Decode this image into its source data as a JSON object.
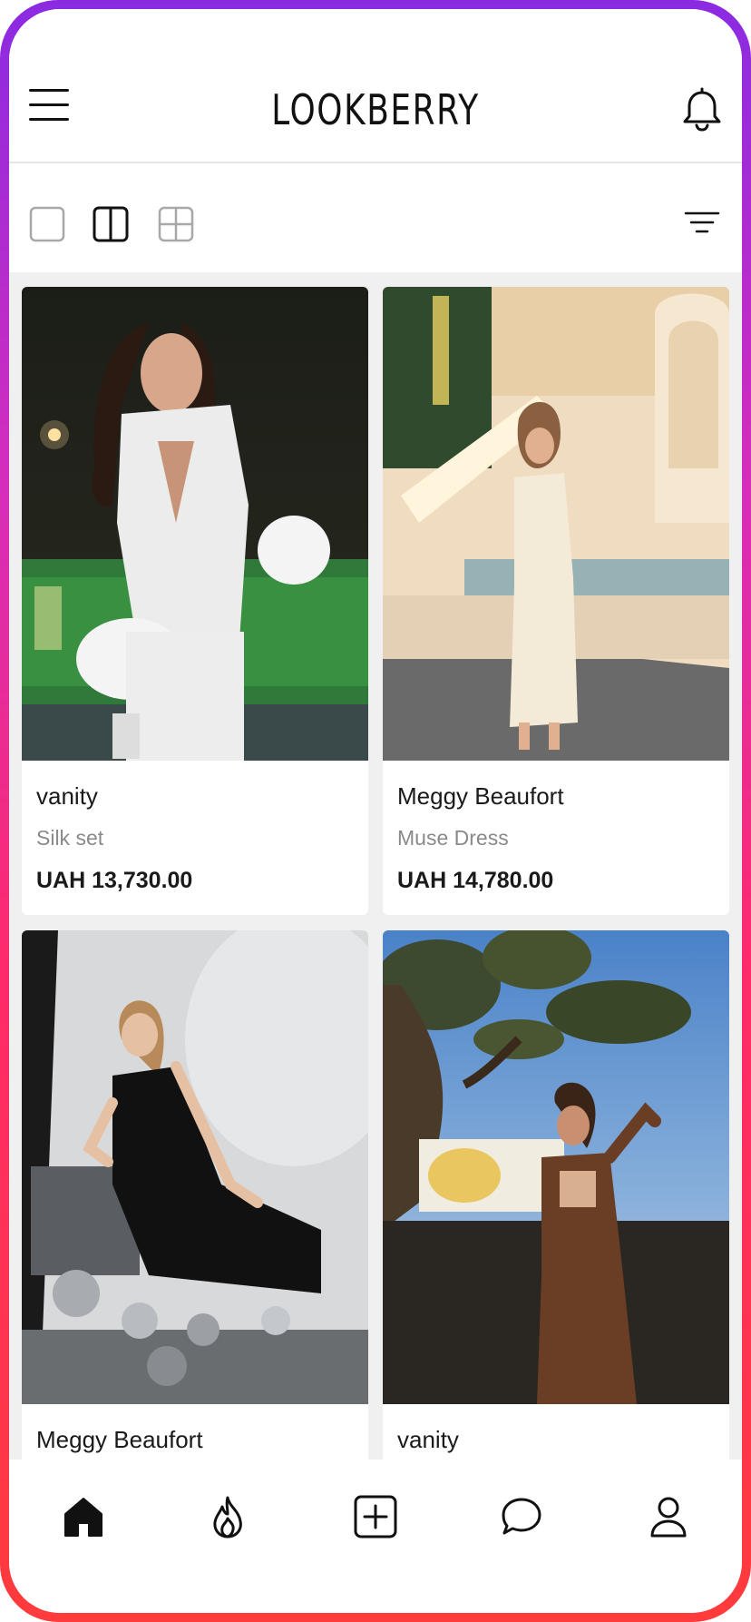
{
  "header": {
    "logo": "LOOKBERRY",
    "menu_icon": "hamburger-menu-icon",
    "notification_icon": "bell-icon"
  },
  "toolbar": {
    "view_options": [
      "single-column-view-icon",
      "two-column-view-icon",
      "four-grid-view-icon"
    ],
    "active_view": "two-column",
    "filter_icon": "filter-icon"
  },
  "products": [
    {
      "brand": "vanity",
      "name": "Silk set",
      "price": "UAH 13,730.00"
    },
    {
      "brand": "Meggy Beaufort",
      "name": "Muse Dress",
      "price": "UAH 14,780.00"
    },
    {
      "brand": "Meggy Beaufort",
      "name": "",
      "price": ""
    },
    {
      "brand": "vanity",
      "name": "",
      "price": ""
    }
  ],
  "bottom_nav": {
    "items": [
      "home-icon",
      "fire-icon",
      "add-square-icon",
      "chat-bubble-icon",
      "profile-icon"
    ],
    "active": "home"
  },
  "colors": {
    "frame_gradient": [
      "#8a2be2",
      "#d62dbb",
      "#ff2a6a",
      "#ff3b3b"
    ],
    "text_primary": "#1a1a1a",
    "text_secondary": "#8a8a8a",
    "grid_background": "#f0f0f0"
  }
}
